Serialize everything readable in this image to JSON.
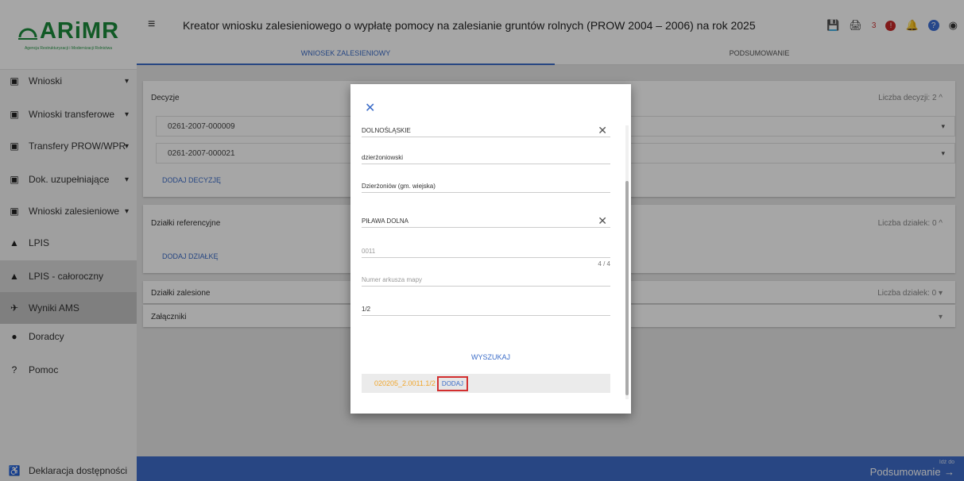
{
  "logo": {
    "name": "ARiMR",
    "subtitle": "Agencja Restrukturyzacji i Modernizacji Rolnictwa"
  },
  "sidebar": {
    "items": [
      {
        "label": "Wnioski",
        "icon": "clipboard-icon"
      },
      {
        "label": "Wnioski transferowe",
        "icon": "clipboard-icon"
      },
      {
        "label": "Transfery PROW/WPR",
        "icon": "clipboard-icon"
      },
      {
        "label": "Dok. uzupełniające",
        "icon": "clipboard-icon"
      },
      {
        "label": "Wnioski zalesieniowe",
        "icon": "clipboard-icon"
      },
      {
        "label": "LPIS",
        "icon": "mountain-icon"
      },
      {
        "label": "LPIS - całoroczny",
        "icon": "mountain-icon"
      },
      {
        "label": "Wyniki AMS",
        "icon": "satellite-icon"
      },
      {
        "label": "Doradcy",
        "icon": "person-icon"
      },
      {
        "label": "Pomoc",
        "icon": "help-icon"
      }
    ],
    "accessibility": "Deklaracja dostępności"
  },
  "header": {
    "title": "Kreator wniosku zalesieniowego o wypłatę pomocy na zalesianie gruntów rolnych (PROW 2004 – 2006) na rok 2025",
    "notif_count": "3",
    "tabs": [
      "WNIOSEK ZALESIENIOWY",
      "PODSUMOWANIE"
    ]
  },
  "content": {
    "decisions_label": "Decyzje",
    "decisions_count": "Liczba decyzji: 2",
    "decisions": [
      "0261-2007-000009",
      "0261-2007-000021"
    ],
    "add_decision": "DODAJ DECYZJĘ",
    "ref_label": "Działki referencyjne",
    "ref_count": "Liczba działek: 0",
    "add_plot": "DODAJ DZIAŁKĘ",
    "forest_label": "Działki zalesione",
    "forest_count": "Liczba działek: 0",
    "attachments_label": "Załączniki"
  },
  "footer": {
    "small": "Idź do",
    "big": "Podsumowanie"
  },
  "modal": {
    "voivodeship": "DOLNOŚLĄSKIE",
    "county": "dzierżoniowski",
    "commune": "Dzierżoniów (gm. wiejska)",
    "precinct": "PIŁAWA DOLNA",
    "precinct_no": "0011",
    "counter": "4 / 4",
    "map_sheet_placeholder": "Numer arkusza mapy",
    "plot_no": "1/2",
    "search": "WYSZUKAJ",
    "result_id": "020205_2.0011.1/2",
    "add": "DODAJ"
  }
}
